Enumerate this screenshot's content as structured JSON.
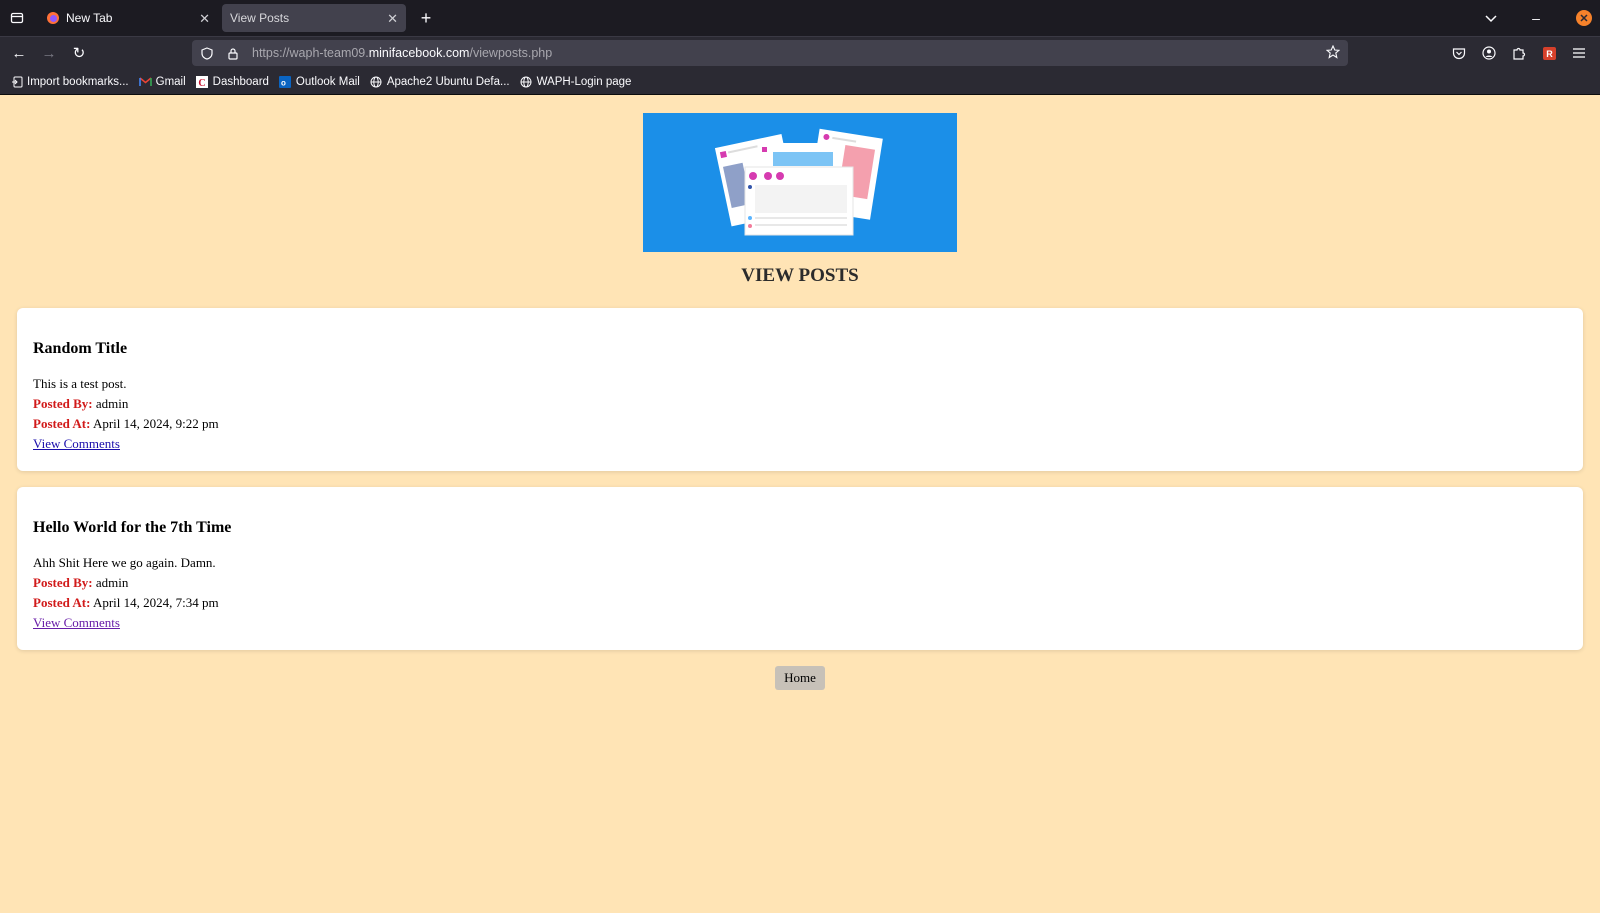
{
  "browser": {
    "tabs": [
      {
        "title": "New Tab"
      },
      {
        "title": "View Posts"
      }
    ],
    "url": {
      "prefix": "https://waph-team09.",
      "domain": "minifacebook.com",
      "path": "/viewposts.php"
    },
    "bookmarks": [
      {
        "label": "Import bookmarks...",
        "icon": "import-icon"
      },
      {
        "label": "Gmail",
        "icon": "gmail-icon"
      },
      {
        "label": "Dashboard",
        "icon": "dashboard-icon"
      },
      {
        "label": "Outlook Mail",
        "icon": "outlook-icon"
      },
      {
        "label": "Apache2 Ubuntu Defa...",
        "icon": "globe-icon"
      },
      {
        "label": "WAPH-Login page",
        "icon": "globe-icon"
      }
    ]
  },
  "page": {
    "title": "VIEW POSTS",
    "labels": {
      "posted_by": "Posted By:",
      "posted_at": "Posted At:",
      "view_comments": "View Comments"
    },
    "posts": [
      {
        "title": "Random Title",
        "body": "This is a test post.",
        "author": "admin",
        "time": "April 14, 2024, 9:22 pm"
      },
      {
        "title": "Hello World for the 7th Time",
        "body": "Ahh Shit Here we go again. Damn.",
        "author": "admin",
        "time": "April 14, 2024, 7:34 pm"
      }
    ],
    "home_label": "Home"
  },
  "colors": {
    "page_bg": "#ffe4b5",
    "banner_bg": "#1b8fe8",
    "label_red": "#d11a1a"
  }
}
